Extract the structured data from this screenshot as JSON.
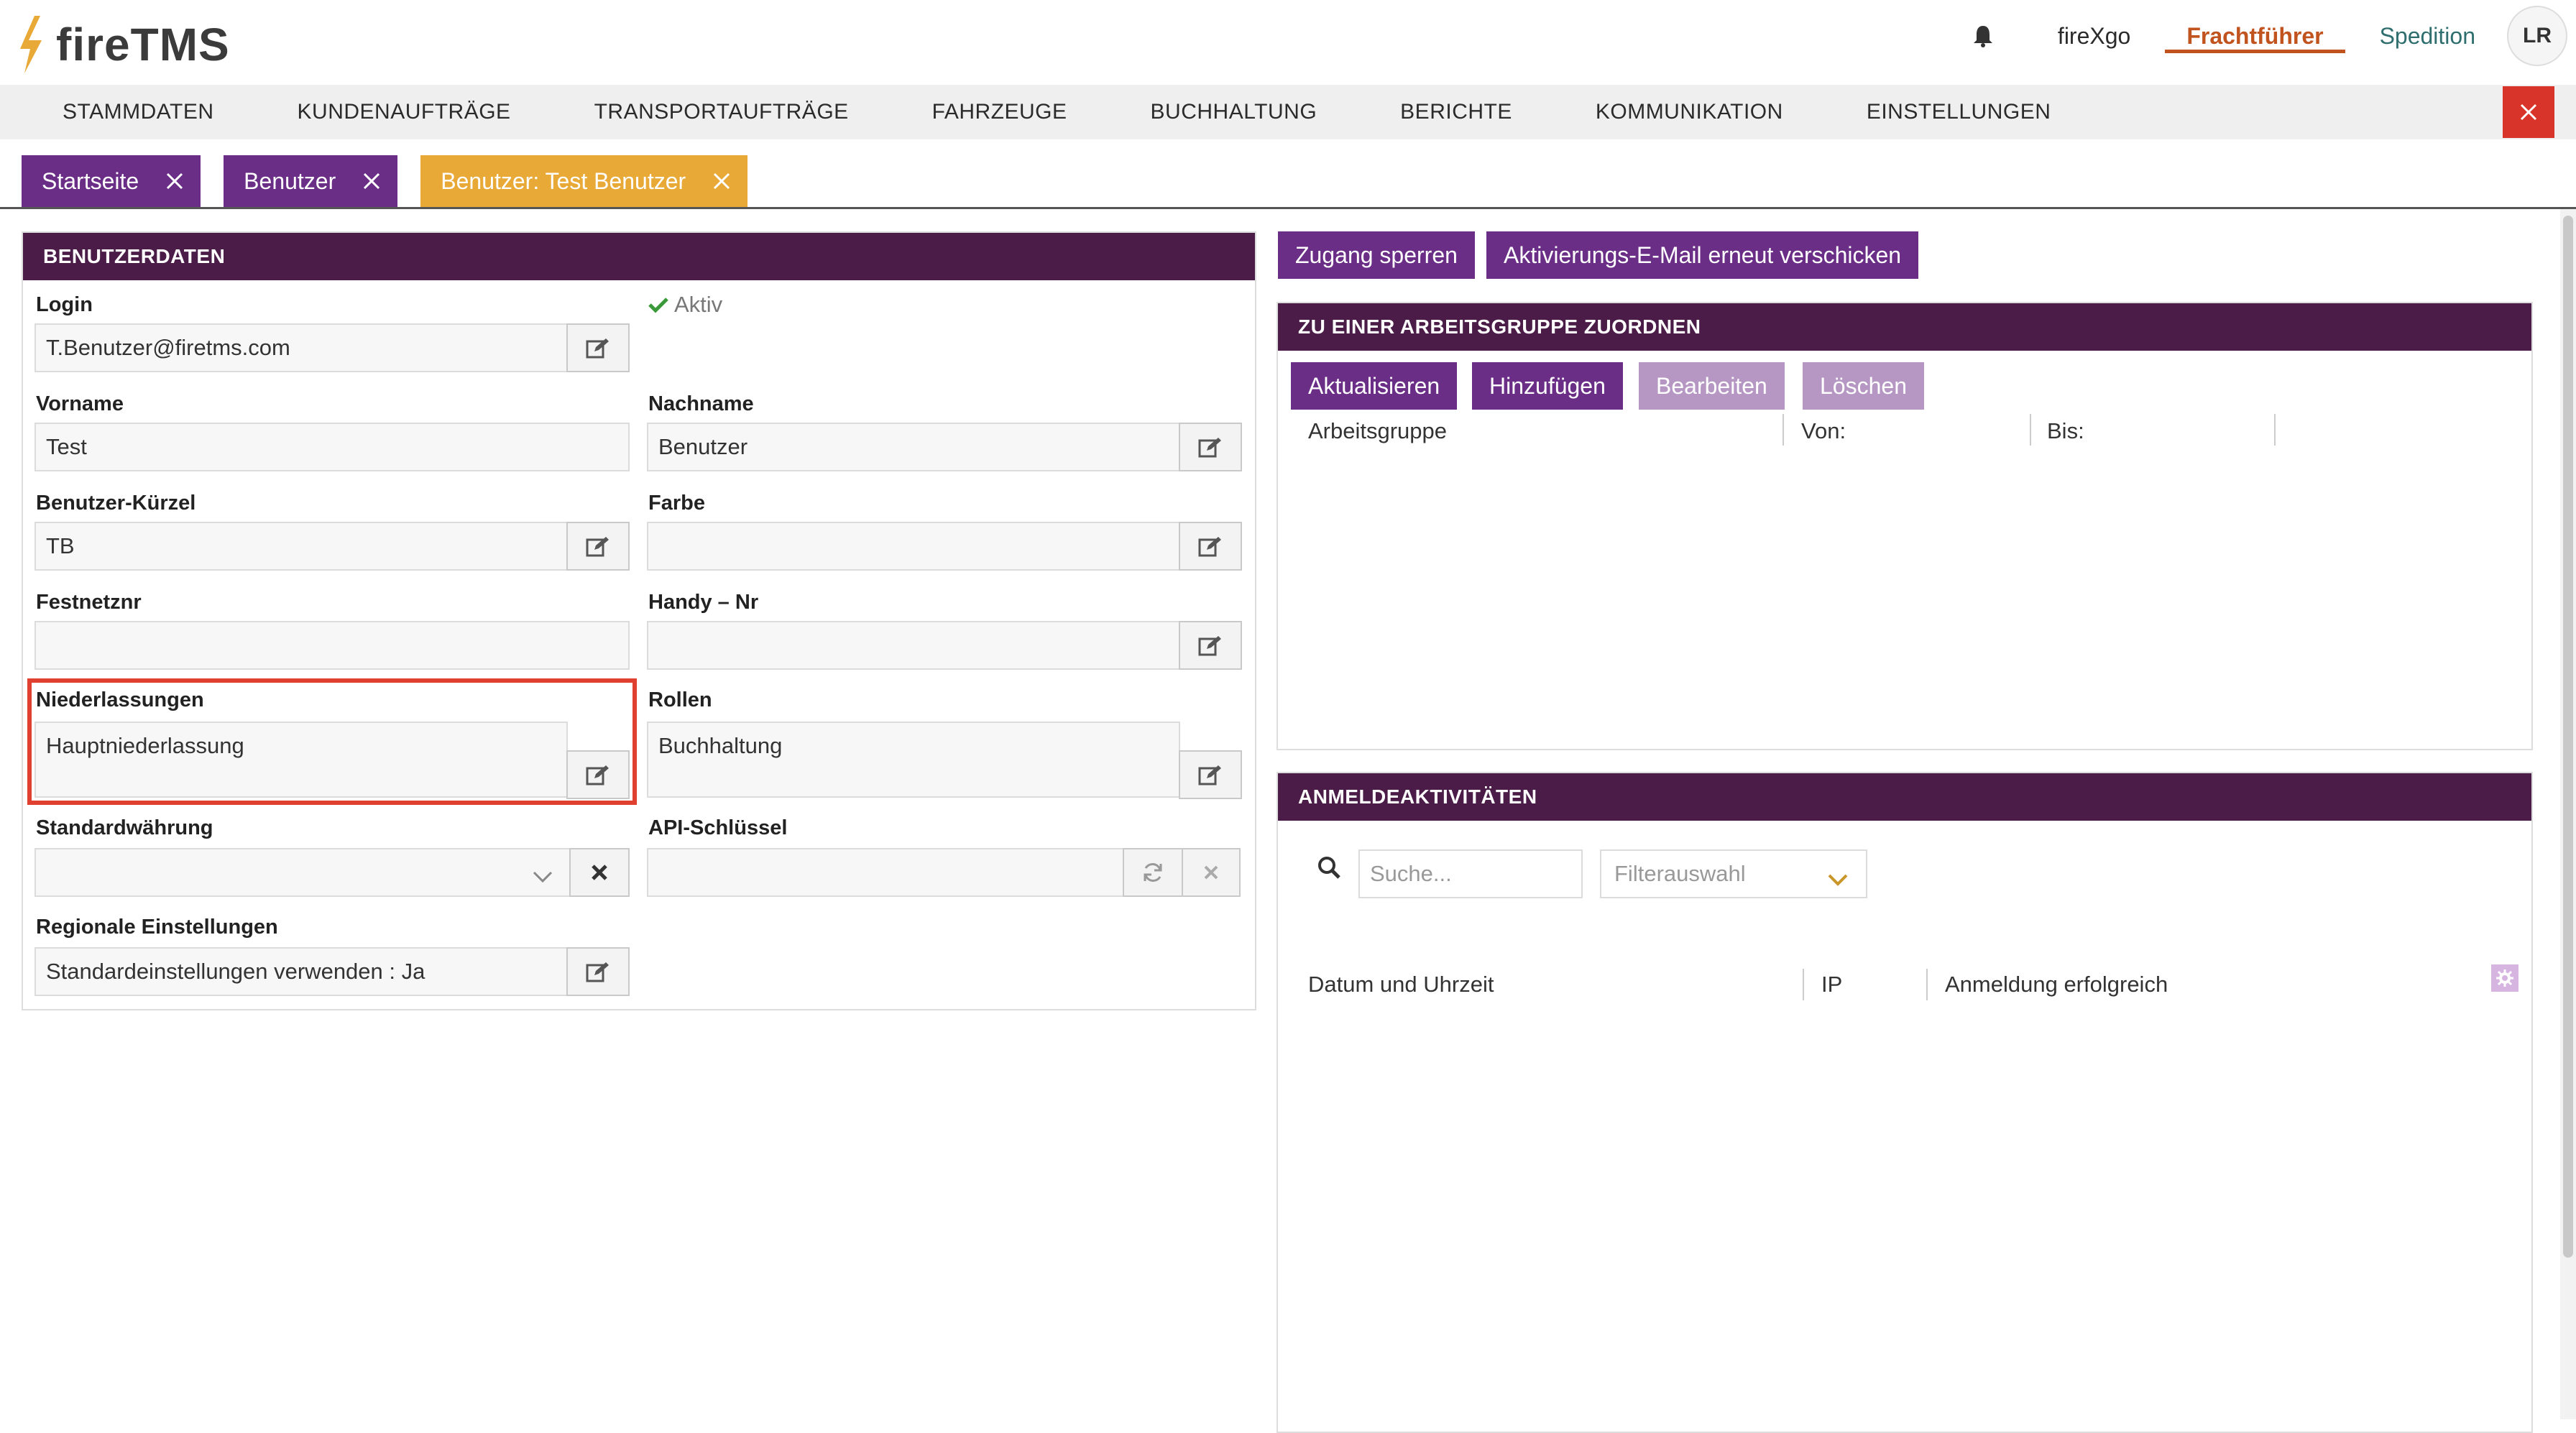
{
  "app": {
    "logo_text": "fireTMS"
  },
  "topbar": {
    "links": [
      {
        "label": "fireXgo"
      },
      {
        "label": "Frachtführer"
      },
      {
        "label": "Spedition"
      }
    ],
    "avatar_initials": "LR"
  },
  "nav": {
    "items": [
      "STAMMDATEN",
      "KUNDENAUFTRÄGE",
      "TRANSPORTAUFTRÄGE",
      "FAHRZEUGE",
      "BUCHHALTUNG",
      "BERICHTE",
      "KOMMUNIKATION",
      "EINSTELLUNGEN"
    ]
  },
  "tabs": [
    {
      "label": "Startseite"
    },
    {
      "label": "Benutzer"
    },
    {
      "label": "Benutzer: Test Benutzer"
    }
  ],
  "user_form": {
    "title": "BENUTZERDATEN",
    "status": "Aktiv",
    "login_label": "Login",
    "login_value": "T.Benutzer@firetms.com",
    "vorname_label": "Vorname",
    "vorname_value": "Test",
    "nachname_label": "Nachname",
    "nachname_value": "Benutzer",
    "kuerzel_label": "Benutzer-Kürzel",
    "kuerzel_value": "TB",
    "farbe_label": "Farbe",
    "farbe_value": "",
    "festnetz_label": "Festnetznr",
    "festnetz_value": "",
    "handy_label": "Handy – Nr",
    "handy_value": "",
    "niederlassungen_label": "Niederlassungen",
    "niederlassungen_value": "Hauptniederlassung",
    "rollen_label": "Rollen",
    "rollen_value": "Buchhaltung",
    "waehrung_label": "Standardwährung",
    "waehrung_value": "",
    "api_label": "API-Schlüssel",
    "api_value": "",
    "regional_label": "Regionale Einstellungen",
    "regional_value": "Standardeinstellungen verwenden : Ja"
  },
  "actions": {
    "block_label": "Zugang sperren",
    "resend_label": "Aktivierungs-E-Mail erneut verschicken"
  },
  "workgroup": {
    "title": "ZU EINER ARBEITSGRUPPE ZUORDNEN",
    "buttons": [
      "Aktualisieren",
      "Hinzufügen",
      "Bearbeiten",
      "Löschen"
    ],
    "columns": [
      "Arbeitsgruppe",
      "Von:",
      "Bis:"
    ]
  },
  "login_activity": {
    "title": "ANMELDEAKTIVITÄTEN",
    "search_placeholder": "Suche...",
    "filter_placeholder": "Filterauswahl",
    "columns": [
      "Datum und Uhrzeit",
      "IP",
      "Anmeldung erfolgreich"
    ]
  },
  "colors": {
    "primary_purple": "#6b2e87",
    "header_dark": "#4a1c47",
    "accent_orange": "#e8a936",
    "active_link": "#c0531e",
    "highlight_red": "#e0402f"
  }
}
